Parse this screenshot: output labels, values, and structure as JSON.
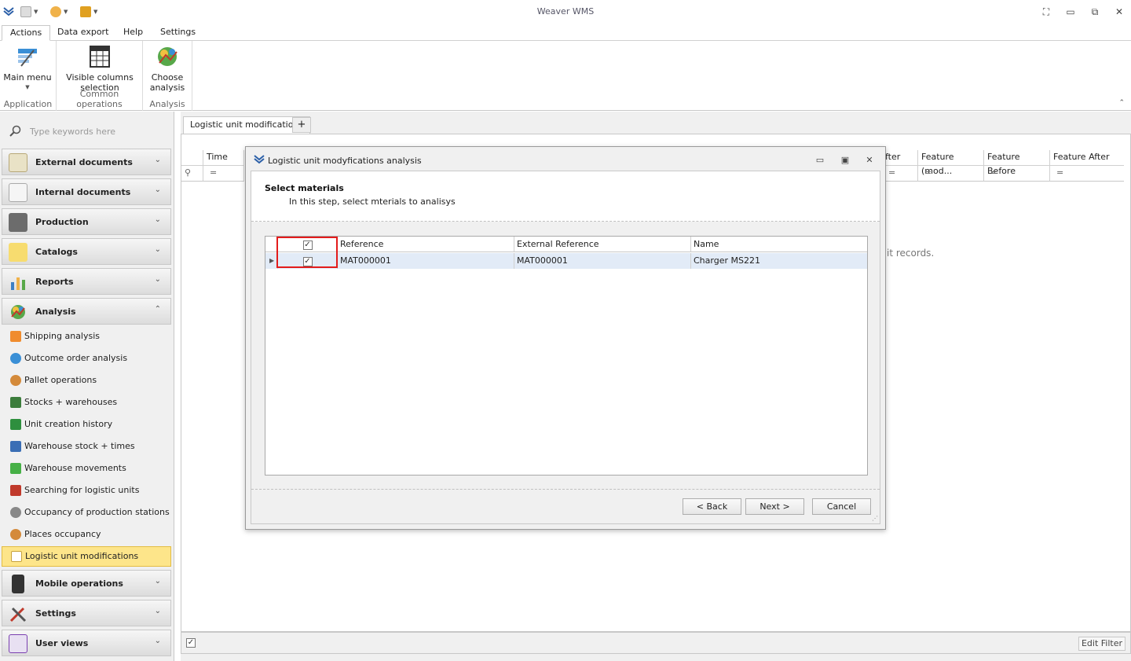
{
  "window": {
    "title": "Weaver WMS",
    "controls": [
      "restore-down",
      "minimize",
      "maximize",
      "close"
    ]
  },
  "ribbon": {
    "tabs": [
      "Actions",
      "Data export",
      "Help",
      "Settings"
    ],
    "active_tab": "Actions",
    "groups": [
      {
        "label": "Application",
        "buttons": [
          {
            "label": "Main menu",
            "icon": "main-menu-icon"
          }
        ]
      },
      {
        "label": "Common operations",
        "buttons": [
          {
            "label": "Visible columns selection",
            "icon": "columns-icon"
          }
        ]
      },
      {
        "label": "Analysis",
        "buttons": [
          {
            "label": "Choose analysis",
            "icon": "analysis-icon"
          }
        ]
      }
    ]
  },
  "sidebar": {
    "search_placeholder": "Type keywords here",
    "groups": [
      {
        "label": "External documents",
        "icon": "external-documents-icon",
        "color": "#e9e2c6"
      },
      {
        "label": "Internal documents",
        "icon": "internal-documents-icon",
        "color": "#f5f5f5"
      },
      {
        "label": "Production",
        "icon": "production-icon",
        "color": "#6c6c6c"
      },
      {
        "label": "Catalogs",
        "icon": "catalogs-icon",
        "color": "#f7dc6f"
      },
      {
        "label": "Reports",
        "icon": "reports-icon",
        "color": "#3e7fc4"
      },
      {
        "label": "Analysis",
        "icon": "analysis-icon",
        "color": "#58a84a"
      }
    ],
    "analysis_items": [
      {
        "label": "Shipping analysis",
        "icon": "arrow-up-icon",
        "color": "#f08c2e"
      },
      {
        "label": "Outcome order analysis",
        "icon": "gauge-icon",
        "color": "#3a8fd6"
      },
      {
        "label": "Pallet operations",
        "icon": "pallet-icon",
        "color": "#d48a3a"
      },
      {
        "label": "Stocks + warehouses",
        "icon": "truck-icon",
        "color": "#3c7d3c"
      },
      {
        "label": "Unit creation history",
        "icon": "ledger-icon",
        "color": "#2e8f3e"
      },
      {
        "label": "Warehouse stock + times",
        "icon": "grid-icon",
        "color": "#3a6eb5"
      },
      {
        "label": "Warehouse movements",
        "icon": "arrow-right-icon",
        "color": "#46b046"
      },
      {
        "label": "Searching for logistic units",
        "icon": "search-red-icon",
        "color": "#c0392b"
      },
      {
        "label": "Occupancy of production stations",
        "icon": "people-icon",
        "color": "#555555"
      },
      {
        "label": "Places occupancy",
        "icon": "places-icon",
        "color": "#d48a3a"
      },
      {
        "label": "Logistic unit modifications",
        "icon": "logistic-icon",
        "color": "#c8a23a"
      }
    ],
    "selected_item": "Logistic unit modifications",
    "bottom_groups": [
      {
        "label": "Mobile operations",
        "icon": "mobile-icon",
        "color": "#333333"
      },
      {
        "label": "Settings",
        "icon": "settings-tools-icon",
        "color": "#c0392b"
      },
      {
        "label": "User views",
        "icon": "user-views-icon",
        "color": "#7a3fb0"
      }
    ]
  },
  "document": {
    "tab_label": "Logistic unit modifications",
    "add_tab": "+",
    "columns_visible": [
      "Time",
      "fter",
      "Feature (mod...",
      "Feature Before",
      "Feature After"
    ],
    "empty_text": "it records.",
    "edit_filter": "Edit Filter",
    "filter_symbol": "="
  },
  "dialog": {
    "title": "Logistic unit modyfications analysis",
    "step_title": "Select materials",
    "step_desc": "In this step, select mterials to analisys",
    "grid": {
      "columns": [
        "Reference",
        "External Reference",
        "Name"
      ],
      "rows": [
        {
          "checked": true,
          "reference": "MAT000001",
          "external_reference": "MAT000001",
          "name": "Charger MS221"
        }
      ],
      "header_checked": true
    },
    "buttons": {
      "back": "< Back",
      "next": "Next >",
      "cancel": "Cancel"
    },
    "highlight_color": "#e31c1c"
  }
}
